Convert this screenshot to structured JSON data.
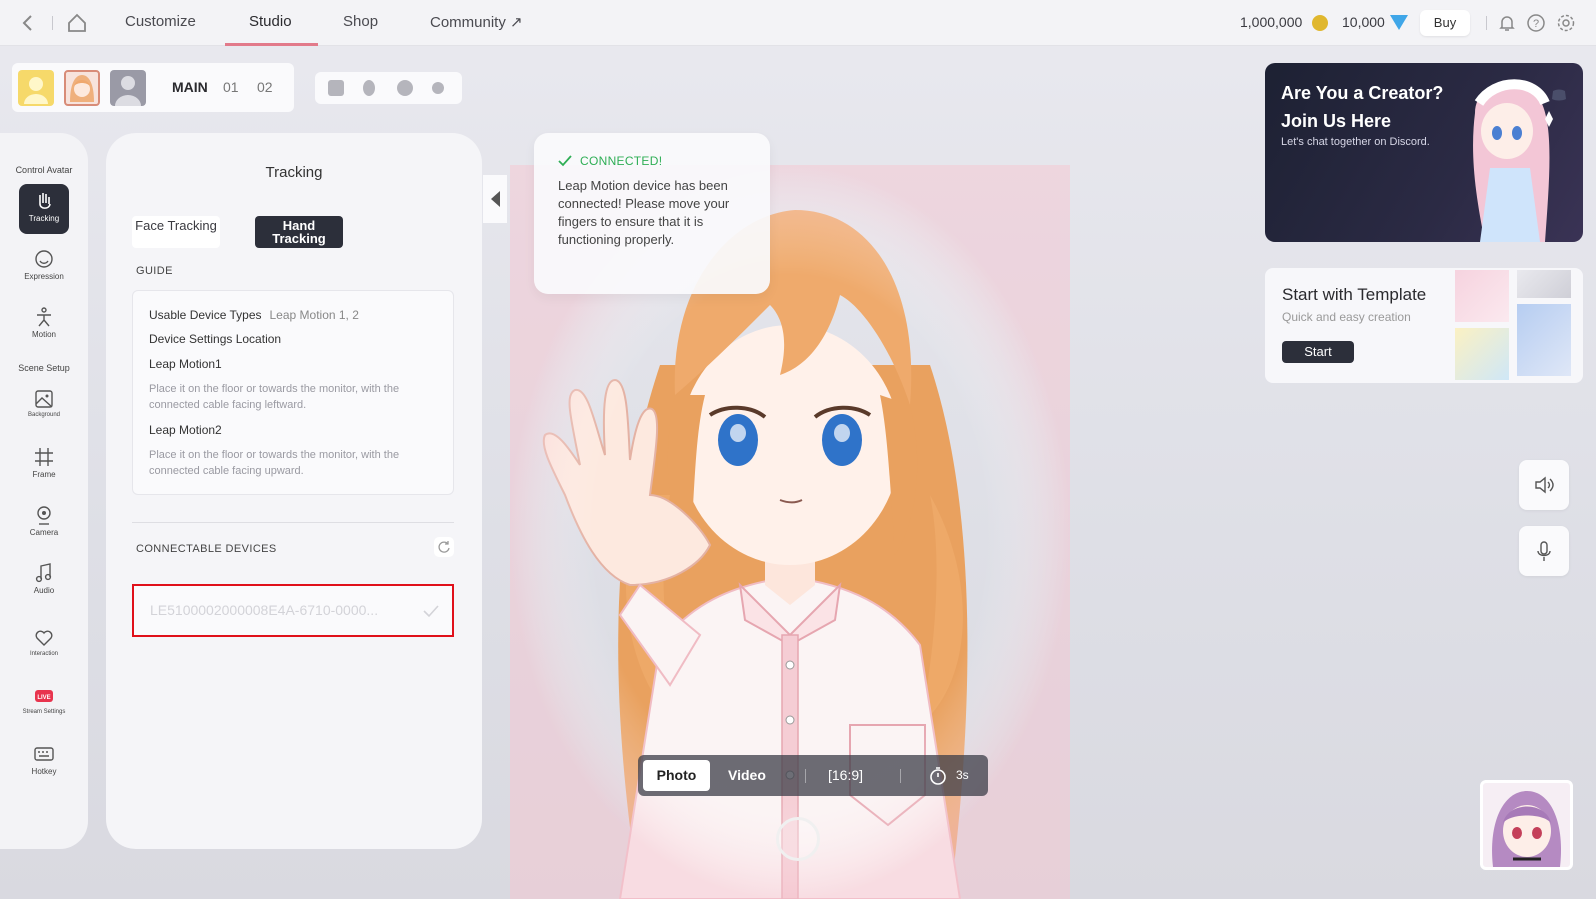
{
  "topbar": {
    "tabs": [
      "Customize",
      "Studio",
      "Shop",
      "Community ↗"
    ],
    "coins": "1,000,000",
    "gems": "10,000",
    "buy_label": "Buy"
  },
  "avatar_bar": {
    "slots": [
      "MAIN",
      "01",
      "02"
    ]
  },
  "rail": {
    "control_header": "Control Avatar",
    "scene_header": "Scene Setup",
    "items": [
      "Tracking",
      "Expression",
      "Motion",
      "Background",
      "Frame",
      "Camera",
      "Audio",
      "Interaction",
      "Stream Settings",
      "Hotkey"
    ],
    "live_badge": "LIVE"
  },
  "panel": {
    "title": "Tracking",
    "face_tab": "Face Tracking",
    "hand_tab": "Hand Tracking",
    "guide_header": "GUIDE",
    "usable_label": "Usable Device Types",
    "usable_value": "Leap Motion 1, 2",
    "settings_label": "Device Settings Location",
    "lm1_label": "Leap Motion1",
    "lm1_desc": "Place it on the floor or towards the monitor, with the connected cable facing leftward.",
    "lm2_label": "Leap Motion2",
    "lm2_desc": "Place it on the floor or towards the monitor, with the connected cable facing upward.",
    "devices_header": "CONNECTABLE DEVICES",
    "device_id": "LE5100002000008E4A-6710-0000..."
  },
  "toast": {
    "status": "CONNECTED!",
    "message": "Leap Motion device has been connected! Please move your fingers to ensure that it is functioning properly."
  },
  "creator_banner": {
    "title_line1": "Are You a Creator?",
    "title_line2": "Join Us Here",
    "subtitle": "Let's chat together on Discord."
  },
  "template_card": {
    "title": "Start with Template",
    "subtitle": "Quick and easy creation",
    "button": "Start"
  },
  "capture": {
    "photo": "Photo",
    "video": "Video",
    "ratio": "16:9",
    "timer": "3s"
  },
  "colors": {
    "accent": "#e27a8a",
    "dark": "#2c2f3a",
    "success": "#2fae55",
    "highlight": "#e0101a"
  }
}
